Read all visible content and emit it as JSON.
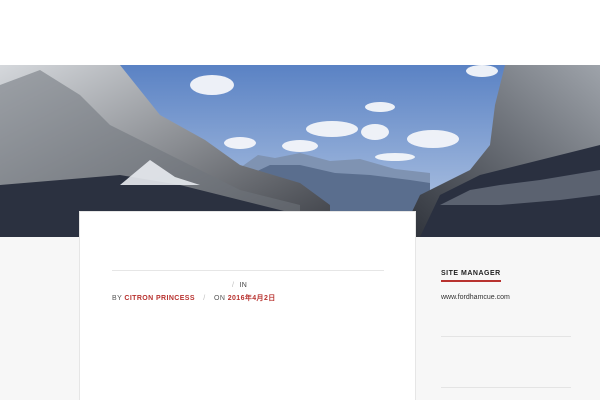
{
  "post": {
    "in_label": "IN",
    "by_label": "BY",
    "author": "CITRON PRINCESS",
    "on_label": "ON",
    "date": "2016年4月2日"
  },
  "sidebar": {
    "widget_title": "SITE MANAGER",
    "link": "www.fordhamcue.com"
  },
  "colors": {
    "accent": "#b8322f",
    "sky_top": "#5a82c4",
    "sky_bottom": "#b9cbe6",
    "page_bg": "#f7f7f7"
  }
}
